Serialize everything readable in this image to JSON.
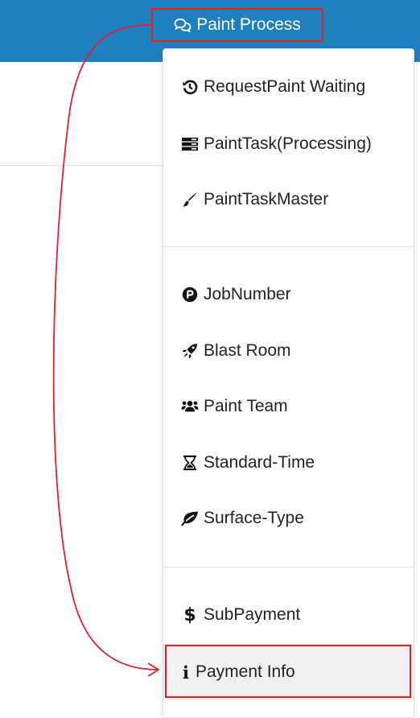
{
  "nav": {
    "paint_process_label": "Paint Process",
    "paint_process_icon": "comments-icon",
    "bar_color": "#1f80bf"
  },
  "dropdown": {
    "groups": [
      [
        {
          "label": "RequestPaint Waiting",
          "icon": "history-icon"
        },
        {
          "label": "PaintTask(Processing)",
          "icon": "server-icon"
        },
        {
          "label": "PaintTaskMaster",
          "icon": "paint-brush-icon"
        }
      ],
      [
        {
          "label": "JobNumber",
          "icon": "product-hunt-icon"
        },
        {
          "label": "Blast Room",
          "icon": "rocket-icon"
        },
        {
          "label": "Paint Team",
          "icon": "users-icon"
        },
        {
          "label": "Standard-Time",
          "icon": "hourglass-icon"
        },
        {
          "label": "Surface-Type",
          "icon": "leaf-icon"
        }
      ],
      [
        {
          "label": "SubPayment",
          "icon": "dollar-icon"
        },
        {
          "label": "Payment Info",
          "icon": "info-icon",
          "active": true
        }
      ]
    ]
  },
  "annotation_color": "#e0202a"
}
